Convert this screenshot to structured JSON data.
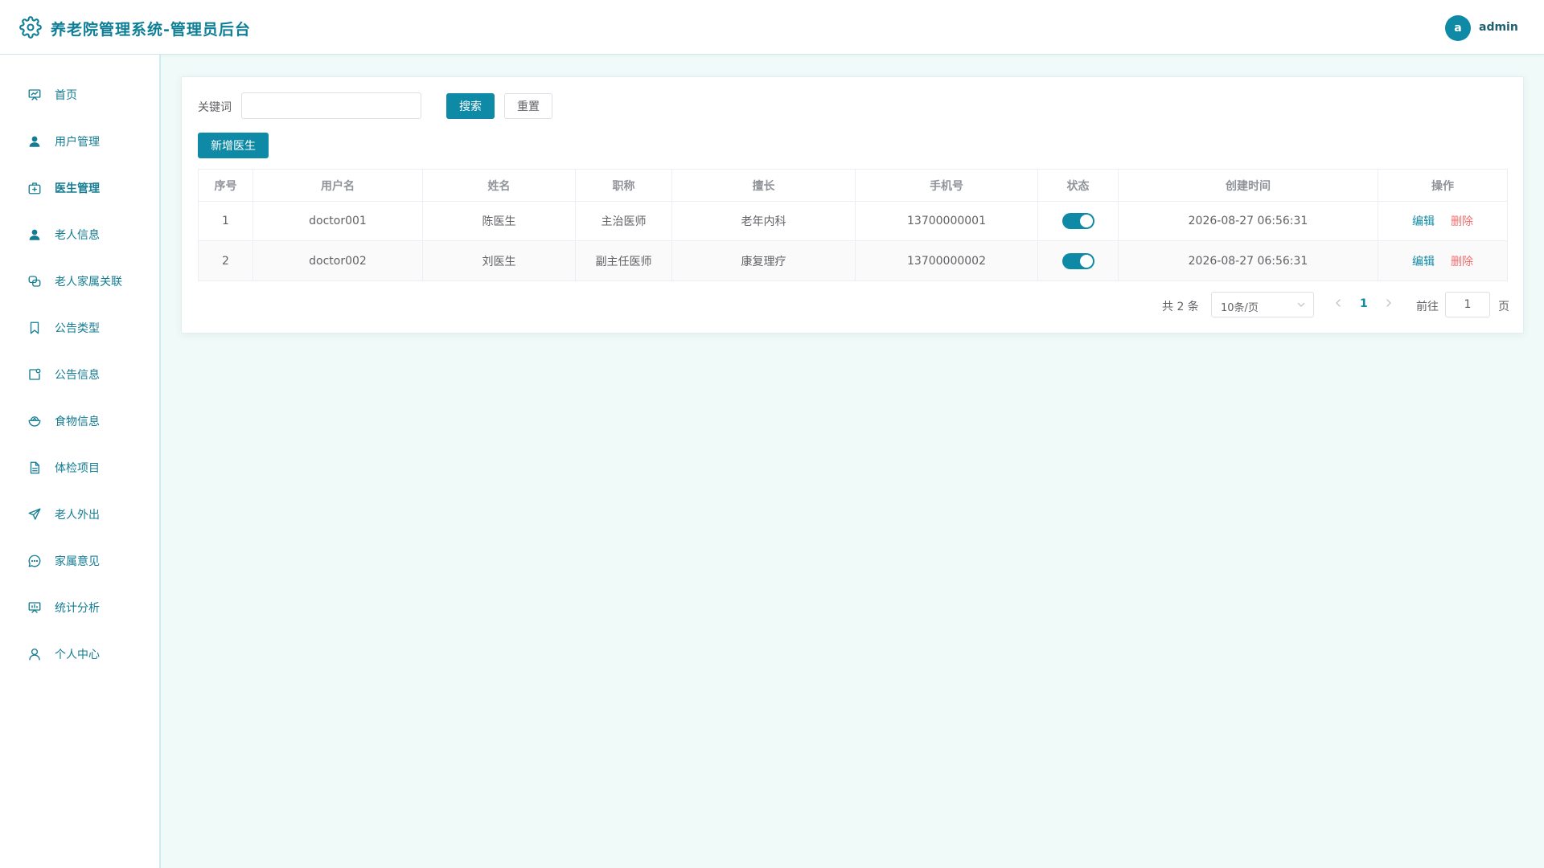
{
  "header": {
    "title": "养老院管理系统-管理员后台",
    "avatar_letter": "a",
    "username": "admin",
    "accent": "#0e8aa6"
  },
  "sidebar": {
    "items": [
      {
        "label": "首页",
        "icon": "dashboard-icon"
      },
      {
        "label": "用户管理",
        "icon": "user-icon"
      },
      {
        "label": "医生管理",
        "icon": "first-aid-kit-icon",
        "active": true
      },
      {
        "label": "老人信息",
        "icon": "user-icon"
      },
      {
        "label": "老人家属关联",
        "icon": "link-icon"
      },
      {
        "label": "公告类型",
        "icon": "bookmark-icon"
      },
      {
        "label": "公告信息",
        "icon": "notice-icon"
      },
      {
        "label": "食物信息",
        "icon": "food-bowl-icon"
      },
      {
        "label": "体检项目",
        "icon": "document-icon"
      },
      {
        "label": "老人外出",
        "icon": "send-icon"
      },
      {
        "label": "家属意见",
        "icon": "chat-icon"
      },
      {
        "label": "统计分析",
        "icon": "chart-board-icon"
      },
      {
        "label": "个人中心",
        "icon": "person-icon"
      }
    ]
  },
  "search": {
    "label": "关键词",
    "value": "",
    "search_btn": "搜索",
    "reset_btn": "重置"
  },
  "actions": {
    "add_btn": "新增医生"
  },
  "table": {
    "headers": [
      "序号",
      "用户名",
      "姓名",
      "职称",
      "擅长",
      "手机号",
      "状态",
      "创建时间",
      "操作"
    ],
    "rows": [
      {
        "no": "1",
        "username": "doctor001",
        "name": "陈医生",
        "title": "主治医师",
        "specialty": "老年内科",
        "phone": "13700000001",
        "status": true,
        "created": "2026-08-27 06:56:31"
      },
      {
        "no": "2",
        "username": "doctor002",
        "name": "刘医生",
        "title": "副主任医师",
        "specialty": "康复理疗",
        "phone": "13700000002",
        "status": true,
        "created": "2026-08-27 06:56:31"
      }
    ],
    "edit_label": "编辑",
    "delete_label": "删除"
  },
  "pagination": {
    "total": "共 2 条",
    "page_size": "10条/页",
    "current_page": "1",
    "goto_label": "前往",
    "goto_value": "1",
    "page_suffix": "页"
  }
}
